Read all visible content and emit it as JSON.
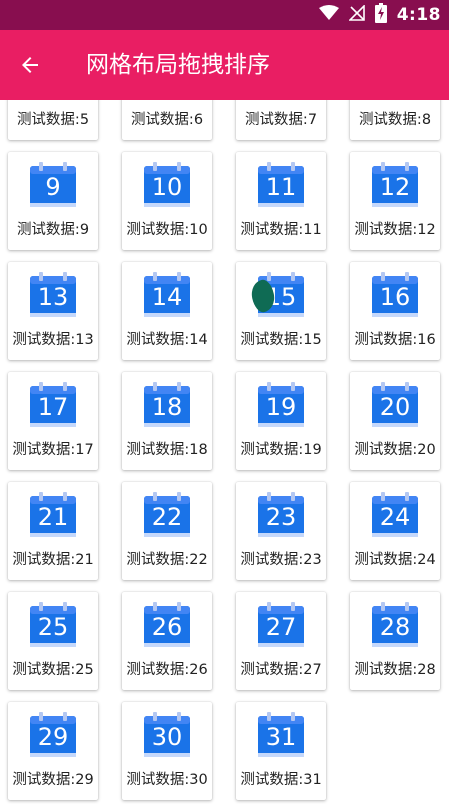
{
  "status_bar": {
    "time": "4:18",
    "icons": [
      "wifi-icon",
      "signal-off-icon",
      "battery-charging-icon"
    ]
  },
  "app_bar": {
    "title": "网格布局拖拽排序",
    "back_icon": "arrow-left-icon"
  },
  "colors": {
    "status_bar": "#880e4f",
    "app_bar": "#e91e63",
    "calendar_body": "#1a73e8",
    "calendar_header": "#4285f4",
    "drag_marker": "#0f6b54"
  },
  "grid": {
    "partial_row": [
      {
        "label": "测试数据:5"
      },
      {
        "label": "测试数据:6"
      },
      {
        "label": "测试数据:7"
      },
      {
        "label": "测试数据:8"
      }
    ],
    "items": [
      {
        "number": "9",
        "label": "测试数据:9"
      },
      {
        "number": "10",
        "label": "测试数据:10"
      },
      {
        "number": "11",
        "label": "测试数据:11"
      },
      {
        "number": "12",
        "label": "测试数据:12"
      },
      {
        "number": "13",
        "label": "测试数据:13"
      },
      {
        "number": "14",
        "label": "测试数据:14"
      },
      {
        "number": "15",
        "label": "测试数据:15",
        "dragging": true
      },
      {
        "number": "16",
        "label": "测试数据:16"
      },
      {
        "number": "17",
        "label": "测试数据:17"
      },
      {
        "number": "18",
        "label": "测试数据:18"
      },
      {
        "number": "19",
        "label": "测试数据:19"
      },
      {
        "number": "20",
        "label": "测试数据:20"
      },
      {
        "number": "21",
        "label": "测试数据:21"
      },
      {
        "number": "22",
        "label": "测试数据:22"
      },
      {
        "number": "23",
        "label": "测试数据:23"
      },
      {
        "number": "24",
        "label": "测试数据:24"
      },
      {
        "number": "25",
        "label": "测试数据:25"
      },
      {
        "number": "26",
        "label": "测试数据:26"
      },
      {
        "number": "27",
        "label": "测试数据:27"
      },
      {
        "number": "28",
        "label": "测试数据:28"
      },
      {
        "number": "29",
        "label": "测试数据:29"
      },
      {
        "number": "30",
        "label": "测试数据:30"
      },
      {
        "number": "31",
        "label": "测试数据:31"
      }
    ]
  }
}
